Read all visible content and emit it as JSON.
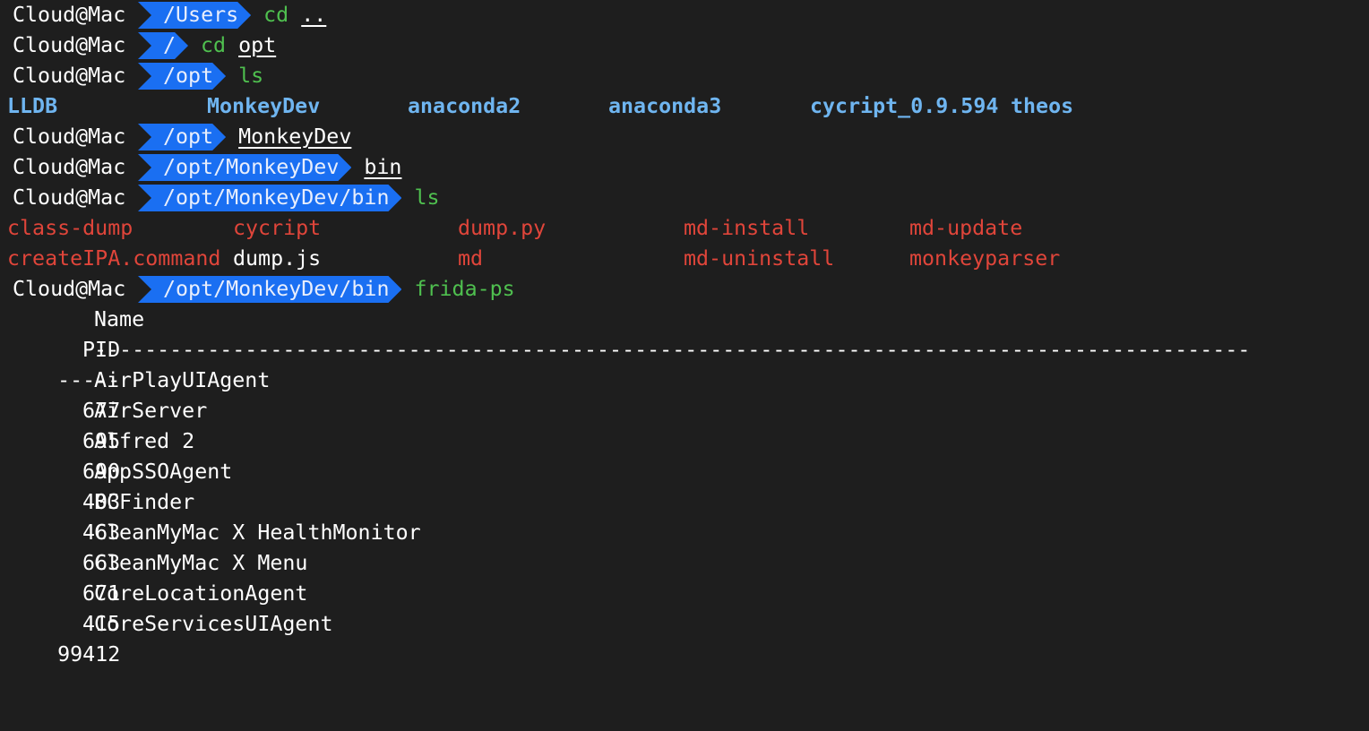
{
  "prompts": [
    {
      "user": "Cloud@Mac",
      "path": "/Users",
      "cmd": "cd",
      "arg": ".."
    },
    {
      "user": "Cloud@Mac",
      "path": "/",
      "cmd": "cd",
      "arg": "opt"
    },
    {
      "user": "Cloud@Mac",
      "path": "/opt",
      "cmd": "ls",
      "arg": ""
    },
    {
      "user": "Cloud@Mac",
      "path": "/opt",
      "cmd": "",
      "arg": "MonkeyDev"
    },
    {
      "user": "Cloud@Mac",
      "path": "/opt/MonkeyDev",
      "cmd": "",
      "arg": "bin"
    },
    {
      "user": "Cloud@Mac",
      "path": "/opt/MonkeyDev/bin",
      "cmd": "ls",
      "arg": ""
    },
    {
      "user": "Cloud@Mac",
      "path": "/opt/MonkeyDev/bin",
      "cmd": "frida-ps",
      "arg": ""
    }
  ],
  "ls_opt": [
    "LLDB",
    "MonkeyDev",
    "anaconda2",
    "anaconda3",
    "cycript_0.9.594",
    "theos"
  ],
  "ls_bin": {
    "row1": [
      "class-dump",
      "cycript",
      "dump.py",
      "md-install",
      "md-update"
    ],
    "row2": [
      "createIPA.command",
      "dump.js",
      "md",
      "md-uninstall",
      "monkeyparser"
    ]
  },
  "ps_header": {
    "pid": "PID",
    "name": "Name"
  },
  "ps_separator": {
    "pid": "-----",
    "name": "--------------------------------------------------------------------------------------------"
  },
  "processes": [
    {
      "pid": "677",
      "name": "AirPlayUIAgent"
    },
    {
      "pid": "695",
      "name": "AirServer"
    },
    {
      "pid": "690",
      "name": "Alfred 2"
    },
    {
      "pid": "403",
      "name": "AppSSOAgent"
    },
    {
      "pid": "463",
      "name": "BCFinder"
    },
    {
      "pid": "663",
      "name": "CleanMyMac X HealthMonitor"
    },
    {
      "pid": "671",
      "name": "CleanMyMac X Menu"
    },
    {
      "pid": "415",
      "name": "CoreLocationAgent"
    },
    {
      "pid": "99412",
      "name": "CoreServicesUIAgent"
    }
  ],
  "colors": {
    "background": "#1e1e1e",
    "prompt_segment": "#1a6ff2",
    "command": "#4fc04f",
    "directory": "#6fb5f0",
    "executable": "#e0453a",
    "text": "#ffffff"
  }
}
